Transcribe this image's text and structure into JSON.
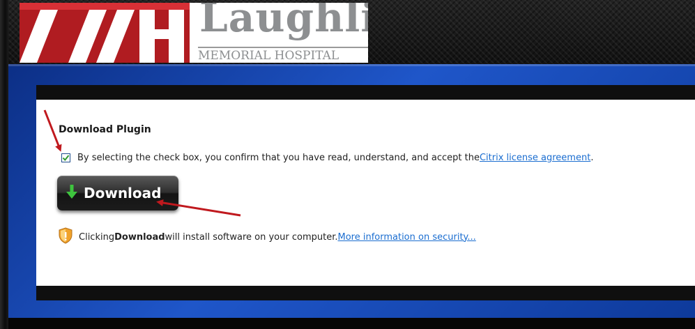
{
  "header": {
    "logo_mark_text": "LMH",
    "logo_word": "Laughlin",
    "logo_sub": "MEMORIAL HOSPITAL"
  },
  "plugin": {
    "title": "Download Plugin",
    "license_text": "By selecting the check box, you confirm that you have read, understand, and accept the ",
    "license_link": "Citrix license agreement",
    "license_period": ".",
    "checkbox_checked": true,
    "download_label": "Download",
    "security_pre": "Clicking ",
    "security_bold": "Download",
    "security_post": " will install software on your computer. ",
    "security_link": "More information on security..."
  },
  "colors": {
    "accent_red": "#c8282d",
    "panel_blue": "#1f56c9",
    "link_blue": "#1a6dd0",
    "check_green": "#2e9a2e",
    "arrow_green": "#3ec43e"
  },
  "icons": {
    "checkbox": "checkmark-icon",
    "download": "down-arrow-icon",
    "security": "shield-warning-icon"
  }
}
